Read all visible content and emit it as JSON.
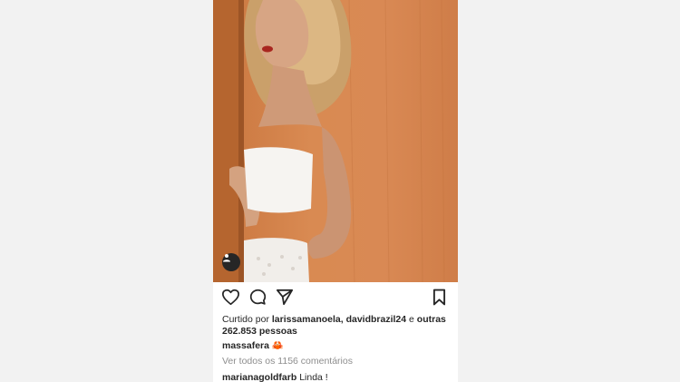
{
  "post": {
    "likes": {
      "prefix": "Curtido por ",
      "users": "larissamanoela, davidbrazil24",
      "conj": " e ",
      "others": "outras",
      "count_line": "262.853 pessoas"
    },
    "caption": {
      "author": "massafera",
      "emoji": "🦀"
    },
    "view_all_comments": "Ver todos os 1156 comentários",
    "comment": {
      "author": "marianagoldfarb",
      "text": "Linda !"
    }
  },
  "icons": [
    "heart-icon",
    "comment-icon",
    "share-icon",
    "bookmark-icon",
    "user-tag-icon"
  ],
  "colors": {
    "background": "#f2f2f2",
    "card": "#ffffff",
    "text": "#262626",
    "muted": "#8e8e8e",
    "photo": "#d98a52"
  }
}
